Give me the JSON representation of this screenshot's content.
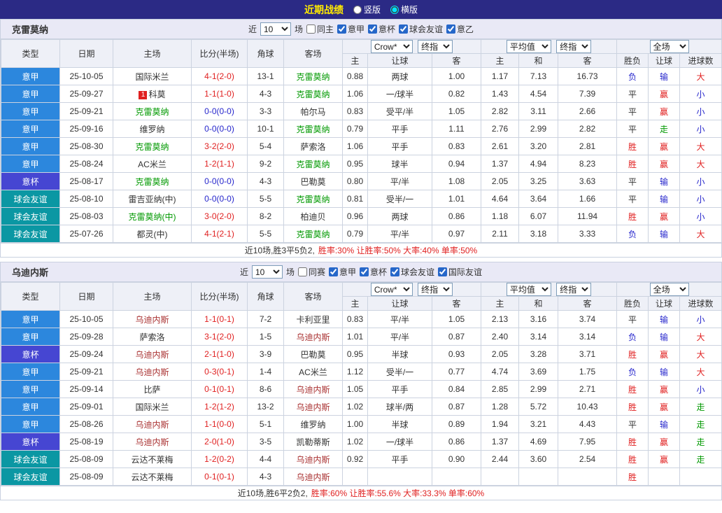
{
  "topbar": {
    "title": "近期战绩",
    "radio_vertical": "竖版",
    "radio_horizontal": "横版",
    "selected": "横版"
  },
  "palette": {
    "red": "#e02020",
    "blue": "#2626cc",
    "green": "#009900",
    "black": "#333333",
    "team_green": "#009900",
    "team_red": "#aa3333"
  },
  "type_colors": {
    "意甲": "#2c87dd",
    "意杯": "#4646d2",
    "球会友谊": "#0b97a3"
  },
  "sections": [
    {
      "team": "克雷莫纳",
      "filter": {
        "prefix": "近",
        "count": "10",
        "suffix": "场",
        "checkboxes": [
          {
            "label": "同主",
            "checked": false
          },
          {
            "label": "意甲",
            "checked": true
          },
          {
            "label": "意杯",
            "checked": true
          },
          {
            "label": "球会友谊",
            "checked": true
          },
          {
            "label": "意乙",
            "checked": true
          }
        ]
      },
      "header": {
        "cols": [
          "类型",
          "日期",
          "主场",
          "比分(半场)",
          "角球",
          "客场"
        ],
        "selects": [
          "Crow*",
          "终指",
          "平均值",
          "终指",
          "全场"
        ],
        "sub": [
          "主",
          "让球",
          "客",
          "主",
          "和",
          "客",
          "胜负",
          "让球",
          "进球数"
        ]
      },
      "rows": [
        {
          "type": "意甲",
          "date": "25-10-05",
          "home": {
            "name": "国际米兰",
            "color": "black"
          },
          "score": {
            "text": "4-1(2-0)",
            "color": "red"
          },
          "corners": "13-1",
          "away": {
            "name": "克雷莫纳",
            "color": "team_green"
          },
          "odds": [
            "0.88",
            "两球",
            "1.00"
          ],
          "avg": [
            "1.17",
            "7.13",
            "16.73"
          ],
          "results": [
            {
              "t": "负",
              "c": "blue"
            },
            {
              "t": "输",
              "c": "blue"
            },
            {
              "t": "大",
              "c": "red"
            }
          ]
        },
        {
          "type": "意甲",
          "date": "25-09-27",
          "home": {
            "name": "科莫",
            "color": "black",
            "badge": "1"
          },
          "score": {
            "text": "1-1(1-0)",
            "color": "red"
          },
          "corners": "4-3",
          "away": {
            "name": "克雷莫纳",
            "color": "team_green"
          },
          "odds": [
            "1.06",
            "一/球半",
            "0.82"
          ],
          "avg": [
            "1.43",
            "4.54",
            "7.39"
          ],
          "results": [
            {
              "t": "平",
              "c": "black"
            },
            {
              "t": "赢",
              "c": "red"
            },
            {
              "t": "小",
              "c": "blue"
            }
          ]
        },
        {
          "type": "意甲",
          "date": "25-09-21",
          "home": {
            "name": "克雷莫纳",
            "color": "team_green"
          },
          "score": {
            "text": "0-0(0-0)",
            "color": "blue"
          },
          "corners": "3-3",
          "away": {
            "name": "帕尔马",
            "color": "black"
          },
          "odds": [
            "0.83",
            "受平/半",
            "1.05"
          ],
          "avg": [
            "2.82",
            "3.11",
            "2.66"
          ],
          "results": [
            {
              "t": "平",
              "c": "black"
            },
            {
              "t": "赢",
              "c": "red"
            },
            {
              "t": "小",
              "c": "blue"
            }
          ]
        },
        {
          "type": "意甲",
          "date": "25-09-16",
          "home": {
            "name": "维罗纳",
            "color": "black"
          },
          "score": {
            "text": "0-0(0-0)",
            "color": "blue"
          },
          "corners": "10-1",
          "away": {
            "name": "克雷莫纳",
            "color": "team_green"
          },
          "odds": [
            "0.79",
            "平手",
            "1.11"
          ],
          "avg": [
            "2.76",
            "2.99",
            "2.82"
          ],
          "results": [
            {
              "t": "平",
              "c": "black"
            },
            {
              "t": "走",
              "c": "green"
            },
            {
              "t": "小",
              "c": "blue"
            }
          ]
        },
        {
          "type": "意甲",
          "date": "25-08-30",
          "home": {
            "name": "克雷莫纳",
            "color": "team_green"
          },
          "score": {
            "text": "3-2(2-0)",
            "color": "red"
          },
          "corners": "5-4",
          "away": {
            "name": "萨索洛",
            "color": "black"
          },
          "odds": [
            "1.06",
            "平手",
            "0.83"
          ],
          "avg": [
            "2.61",
            "3.20",
            "2.81"
          ],
          "results": [
            {
              "t": "胜",
              "c": "red"
            },
            {
              "t": "赢",
              "c": "red"
            },
            {
              "t": "大",
              "c": "red"
            }
          ]
        },
        {
          "type": "意甲",
          "date": "25-08-24",
          "home": {
            "name": "AC米兰",
            "color": "black"
          },
          "score": {
            "text": "1-2(1-1)",
            "color": "red"
          },
          "corners": "9-2",
          "away": {
            "name": "克雷莫纳",
            "color": "team_green"
          },
          "odds": [
            "0.95",
            "球半",
            "0.94"
          ],
          "avg": [
            "1.37",
            "4.94",
            "8.23"
          ],
          "results": [
            {
              "t": "胜",
              "c": "red"
            },
            {
              "t": "赢",
              "c": "red"
            },
            {
              "t": "大",
              "c": "red"
            }
          ]
        },
        {
          "type": "意杯",
          "date": "25-08-17",
          "home": {
            "name": "克雷莫纳",
            "color": "team_green"
          },
          "score": {
            "text": "0-0(0-0)",
            "color": "blue"
          },
          "corners": "4-3",
          "away": {
            "name": "巴勒莫",
            "color": "black"
          },
          "odds": [
            "0.80",
            "平/半",
            "1.08"
          ],
          "avg": [
            "2.05",
            "3.25",
            "3.63"
          ],
          "results": [
            {
              "t": "平",
              "c": "black"
            },
            {
              "t": "输",
              "c": "blue"
            },
            {
              "t": "小",
              "c": "blue"
            }
          ]
        },
        {
          "type": "球会友谊",
          "date": "25-08-10",
          "home": {
            "name": "雷吉亚纳(中)",
            "color": "black"
          },
          "score": {
            "text": "0-0(0-0)",
            "color": "blue"
          },
          "corners": "5-5",
          "away": {
            "name": "克雷莫纳",
            "color": "team_green"
          },
          "odds": [
            "0.81",
            "受半/一",
            "1.01"
          ],
          "avg": [
            "4.64",
            "3.64",
            "1.66"
          ],
          "results": [
            {
              "t": "平",
              "c": "black"
            },
            {
              "t": "输",
              "c": "blue"
            },
            {
              "t": "小",
              "c": "blue"
            }
          ]
        },
        {
          "type": "球会友谊",
          "date": "25-08-03",
          "home": {
            "name": "克雷莫纳(中)",
            "color": "team_green"
          },
          "score": {
            "text": "3-0(2-0)",
            "color": "red"
          },
          "corners": "8-2",
          "away": {
            "name": "柏迪贝",
            "color": "black"
          },
          "odds": [
            "0.96",
            "两球",
            "0.86"
          ],
          "avg": [
            "1.18",
            "6.07",
            "11.94"
          ],
          "results": [
            {
              "t": "胜",
              "c": "red"
            },
            {
              "t": "赢",
              "c": "red"
            },
            {
              "t": "小",
              "c": "blue"
            }
          ]
        },
        {
          "type": "球会友谊",
          "date": "25-07-26",
          "home": {
            "name": "都灵(中)",
            "color": "black"
          },
          "score": {
            "text": "4-1(2-1)",
            "color": "red"
          },
          "corners": "5-5",
          "away": {
            "name": "克雷莫纳",
            "color": "team_green"
          },
          "odds": [
            "0.79",
            "平/半",
            "0.97"
          ],
          "avg": [
            "2.11",
            "3.18",
            "3.33"
          ],
          "results": [
            {
              "t": "负",
              "c": "blue"
            },
            {
              "t": "输",
              "c": "blue"
            },
            {
              "t": "大",
              "c": "red"
            }
          ]
        }
      ],
      "summary": {
        "record": "近10场,胜3平5负2,",
        "rates": "胜率:30% 让胜率:50% 大率:40% 单率:50%"
      }
    },
    {
      "team": "乌迪内斯",
      "filter": {
        "prefix": "近",
        "count": "10",
        "suffix": "场",
        "checkboxes": [
          {
            "label": "同赛",
            "checked": false
          },
          {
            "label": "意甲",
            "checked": true
          },
          {
            "label": "意杯",
            "checked": true
          },
          {
            "label": "球会友谊",
            "checked": true
          },
          {
            "label": "国际友谊",
            "checked": true
          }
        ]
      },
      "header": {
        "cols": [
          "类型",
          "日期",
          "主场",
          "比分(半场)",
          "角球",
          "客场"
        ],
        "selects": [
          "Crow*",
          "终指",
          "平均值",
          "终指",
          "全场"
        ],
        "sub": [
          "主",
          "让球",
          "客",
          "主",
          "和",
          "客",
          "胜负",
          "让球",
          "进球数"
        ]
      },
      "rows": [
        {
          "type": "意甲",
          "date": "25-10-05",
          "home": {
            "name": "乌迪内斯",
            "color": "team_red"
          },
          "score": {
            "text": "1-1(0-1)",
            "color": "red"
          },
          "corners": "7-2",
          "away": {
            "name": "卡利亚里",
            "color": "black"
          },
          "odds": [
            "0.83",
            "平/半",
            "1.05"
          ],
          "avg": [
            "2.13",
            "3.16",
            "3.74"
          ],
          "results": [
            {
              "t": "平",
              "c": "black"
            },
            {
              "t": "输",
              "c": "blue"
            },
            {
              "t": "小",
              "c": "blue"
            }
          ]
        },
        {
          "type": "意甲",
          "date": "25-09-28",
          "home": {
            "name": "萨索洛",
            "color": "black"
          },
          "score": {
            "text": "3-1(2-0)",
            "color": "red"
          },
          "corners": "1-5",
          "away": {
            "name": "乌迪内斯",
            "color": "team_red"
          },
          "odds": [
            "1.01",
            "平/半",
            "0.87"
          ],
          "avg": [
            "2.40",
            "3.14",
            "3.14"
          ],
          "results": [
            {
              "t": "负",
              "c": "blue"
            },
            {
              "t": "输",
              "c": "blue"
            },
            {
              "t": "大",
              "c": "red"
            }
          ]
        },
        {
          "type": "意杯",
          "date": "25-09-24",
          "home": {
            "name": "乌迪内斯",
            "color": "team_red"
          },
          "score": {
            "text": "2-1(1-0)",
            "color": "red"
          },
          "corners": "3-9",
          "away": {
            "name": "巴勒莫",
            "color": "black"
          },
          "odds": [
            "0.95",
            "半球",
            "0.93"
          ],
          "avg": [
            "2.05",
            "3.28",
            "3.71"
          ],
          "results": [
            {
              "t": "胜",
              "c": "red"
            },
            {
              "t": "赢",
              "c": "red"
            },
            {
              "t": "大",
              "c": "red"
            }
          ]
        },
        {
          "type": "意甲",
          "date": "25-09-21",
          "home": {
            "name": "乌迪内斯",
            "color": "team_red"
          },
          "score": {
            "text": "0-3(0-1)",
            "color": "red"
          },
          "corners": "1-4",
          "away": {
            "name": "AC米兰",
            "color": "black"
          },
          "odds": [
            "1.12",
            "受半/一",
            "0.77"
          ],
          "avg": [
            "4.74",
            "3.69",
            "1.75"
          ],
          "results": [
            {
              "t": "负",
              "c": "blue"
            },
            {
              "t": "输",
              "c": "blue"
            },
            {
              "t": "大",
              "c": "red"
            }
          ]
        },
        {
          "type": "意甲",
          "date": "25-09-14",
          "home": {
            "name": "比萨",
            "color": "black"
          },
          "score": {
            "text": "0-1(0-1)",
            "color": "red"
          },
          "corners": "8-6",
          "away": {
            "name": "乌迪内斯",
            "color": "team_red"
          },
          "odds": [
            "1.05",
            "平手",
            "0.84"
          ],
          "avg": [
            "2.85",
            "2.99",
            "2.71"
          ],
          "results": [
            {
              "t": "胜",
              "c": "red"
            },
            {
              "t": "赢",
              "c": "red"
            },
            {
              "t": "小",
              "c": "blue"
            }
          ]
        },
        {
          "type": "意甲",
          "date": "25-09-01",
          "home": {
            "name": "国际米兰",
            "color": "black"
          },
          "score": {
            "text": "1-2(1-2)",
            "color": "red"
          },
          "corners": "13-2",
          "away": {
            "name": "乌迪内斯",
            "color": "team_red"
          },
          "odds": [
            "1.02",
            "球半/两",
            "0.87"
          ],
          "avg": [
            "1.28",
            "5.72",
            "10.43"
          ],
          "results": [
            {
              "t": "胜",
              "c": "red"
            },
            {
              "t": "赢",
              "c": "red"
            },
            {
              "t": "走",
              "c": "green"
            }
          ]
        },
        {
          "type": "意甲",
          "date": "25-08-26",
          "home": {
            "name": "乌迪内斯",
            "color": "team_red"
          },
          "score": {
            "text": "1-1(0-0)",
            "color": "red"
          },
          "corners": "5-1",
          "away": {
            "name": "维罗纳",
            "color": "black"
          },
          "odds": [
            "1.00",
            "半球",
            "0.89"
          ],
          "avg": [
            "1.94",
            "3.21",
            "4.43"
          ],
          "results": [
            {
              "t": "平",
              "c": "black"
            },
            {
              "t": "输",
              "c": "blue"
            },
            {
              "t": "走",
              "c": "green"
            }
          ]
        },
        {
          "type": "意杯",
          "date": "25-08-19",
          "home": {
            "name": "乌迪内斯",
            "color": "team_red"
          },
          "score": {
            "text": "2-0(1-0)",
            "color": "red"
          },
          "corners": "3-5",
          "away": {
            "name": "凯勒蒂斯",
            "color": "black"
          },
          "odds": [
            "1.02",
            "一/球半",
            "0.86"
          ],
          "avg": [
            "1.37",
            "4.69",
            "7.95"
          ],
          "results": [
            {
              "t": "胜",
              "c": "red"
            },
            {
              "t": "赢",
              "c": "red"
            },
            {
              "t": "走",
              "c": "green"
            }
          ]
        },
        {
          "type": "球会友谊",
          "date": "25-08-09",
          "home": {
            "name": "云达不莱梅",
            "color": "black"
          },
          "score": {
            "text": "1-2(0-2)",
            "color": "red"
          },
          "corners": "4-4",
          "away": {
            "name": "乌迪内斯",
            "color": "team_red"
          },
          "odds": [
            "0.92",
            "平手",
            "0.90"
          ],
          "avg": [
            "2.44",
            "3.60",
            "2.54"
          ],
          "results": [
            {
              "t": "胜",
              "c": "red"
            },
            {
              "t": "赢",
              "c": "red"
            },
            {
              "t": "走",
              "c": "green"
            }
          ]
        },
        {
          "type": "球会友谊",
          "date": "25-08-09",
          "home": {
            "name": "云达不莱梅",
            "color": "black"
          },
          "score": {
            "text": "0-1(0-1)",
            "color": "red"
          },
          "corners": "4-3",
          "away": {
            "name": "乌迪内斯",
            "color": "team_red"
          },
          "odds": [
            "",
            "",
            ""
          ],
          "avg": [
            "",
            "",
            ""
          ],
          "results": [
            {
              "t": "胜",
              "c": "red"
            },
            {
              "t": "",
              "c": "black"
            },
            {
              "t": "",
              "c": "black"
            }
          ]
        }
      ],
      "summary": {
        "record": "近10场,胜6平2负2,",
        "rates": "胜率:60% 让胜率:55.6% 大率:33.3% 单率:60%"
      }
    }
  ]
}
